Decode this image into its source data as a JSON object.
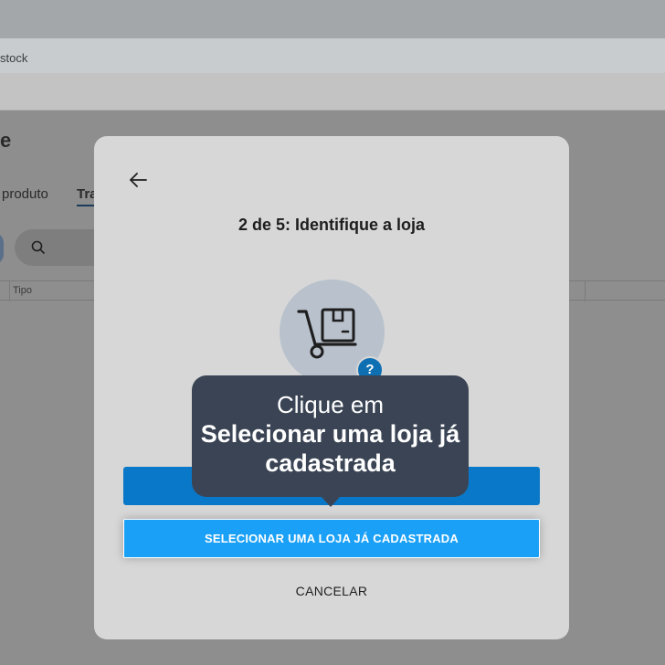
{
  "browser": {
    "address_text": "stock"
  },
  "background_page": {
    "heading": "e",
    "tabs": [
      {
        "label": "produto"
      },
      {
        "label": "Tra"
      }
    ],
    "table_columns": [
      {
        "label": "Tipo"
      }
    ]
  },
  "modal": {
    "title": "2 de 5: Identifique a loja",
    "help_badge": "?",
    "select_store_label": "SELECIONAR UMA LOJA JÁ CADASTRADA",
    "cancel_label": "CANCELAR",
    "icons": {
      "back": "arrow-left-icon",
      "illustration": "hand-truck-box-icon",
      "help": "help-icon"
    }
  },
  "tooltip": {
    "line1": "Clique em",
    "line2": "Selecionar uma loja já cadastrada"
  },
  "colors": {
    "primary": "#1aa0f7",
    "tooltip_bg": "#3a4454",
    "help_badge": "#0e6fb3"
  }
}
